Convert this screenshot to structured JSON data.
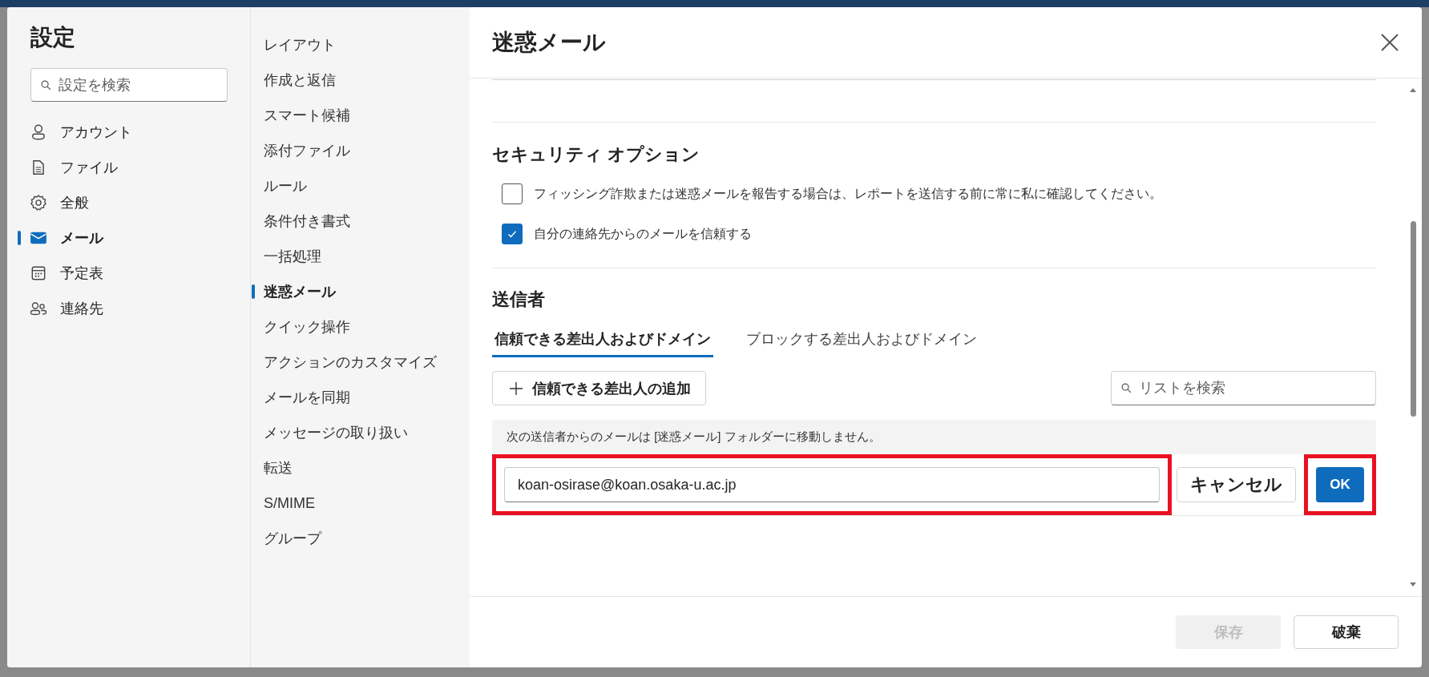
{
  "window": {
    "title": "設定"
  },
  "search": {
    "placeholder": "設定を検索"
  },
  "categories": [
    {
      "label": "アカウント",
      "kind": "person",
      "selected": false
    },
    {
      "label": "ファイル",
      "kind": "file",
      "selected": false
    },
    {
      "label": "全般",
      "kind": "gear",
      "selected": false
    },
    {
      "label": "メール",
      "kind": "mail",
      "selected": true
    },
    {
      "label": "予定表",
      "kind": "calendar",
      "selected": false
    },
    {
      "label": "連絡先",
      "kind": "people",
      "selected": false
    }
  ],
  "subcategories": [
    {
      "label": "レイアウト",
      "selected": false
    },
    {
      "label": "作成と返信",
      "selected": false
    },
    {
      "label": "スマート候補",
      "selected": false
    },
    {
      "label": "添付ファイル",
      "selected": false
    },
    {
      "label": "ルール",
      "selected": false
    },
    {
      "label": "条件付き書式",
      "selected": false
    },
    {
      "label": "一括処理",
      "selected": false
    },
    {
      "label": "迷惑メール",
      "selected": true
    },
    {
      "label": "クイック操作",
      "selected": false
    },
    {
      "label": "アクションのカスタマイズ",
      "selected": false
    },
    {
      "label": "メールを同期",
      "selected": false
    },
    {
      "label": "メッセージの取り扱い",
      "selected": false
    },
    {
      "label": "転送",
      "selected": false
    },
    {
      "label": "S/MIME",
      "selected": false
    },
    {
      "label": "グループ",
      "selected": false
    }
  ],
  "panel": {
    "title": "迷惑メール"
  },
  "security": {
    "heading": "セキュリティ オプション",
    "options": [
      {
        "label": "フィッシング詐欺または迷惑メールを報告する場合は、レポートを送信する前に常に私に確認してください。",
        "checked": false
      },
      {
        "label": "自分の連絡先からのメールを信頼する",
        "checked": true
      }
    ]
  },
  "senders": {
    "heading": "送信者",
    "tabs": [
      {
        "label": "信頼できる差出人およびドメイン",
        "selected": true
      },
      {
        "label": "ブロックする差出人およびドメイン",
        "selected": false
      }
    ],
    "add_button": "信頼できる差出人の追加",
    "list_search": {
      "placeholder": "リストを検索"
    },
    "notice": "次の送信者からのメールは [迷惑メール] フォルダーに移動しません。",
    "entry": {
      "value": "koan-osirase@koan.osaka-u.ac.jp",
      "cancel": "キャンセル",
      "ok": "OK"
    }
  },
  "footer": {
    "buttons": [
      {
        "label": "保存",
        "disabled": true
      },
      {
        "label": "破棄",
        "disabled": false
      }
    ]
  }
}
